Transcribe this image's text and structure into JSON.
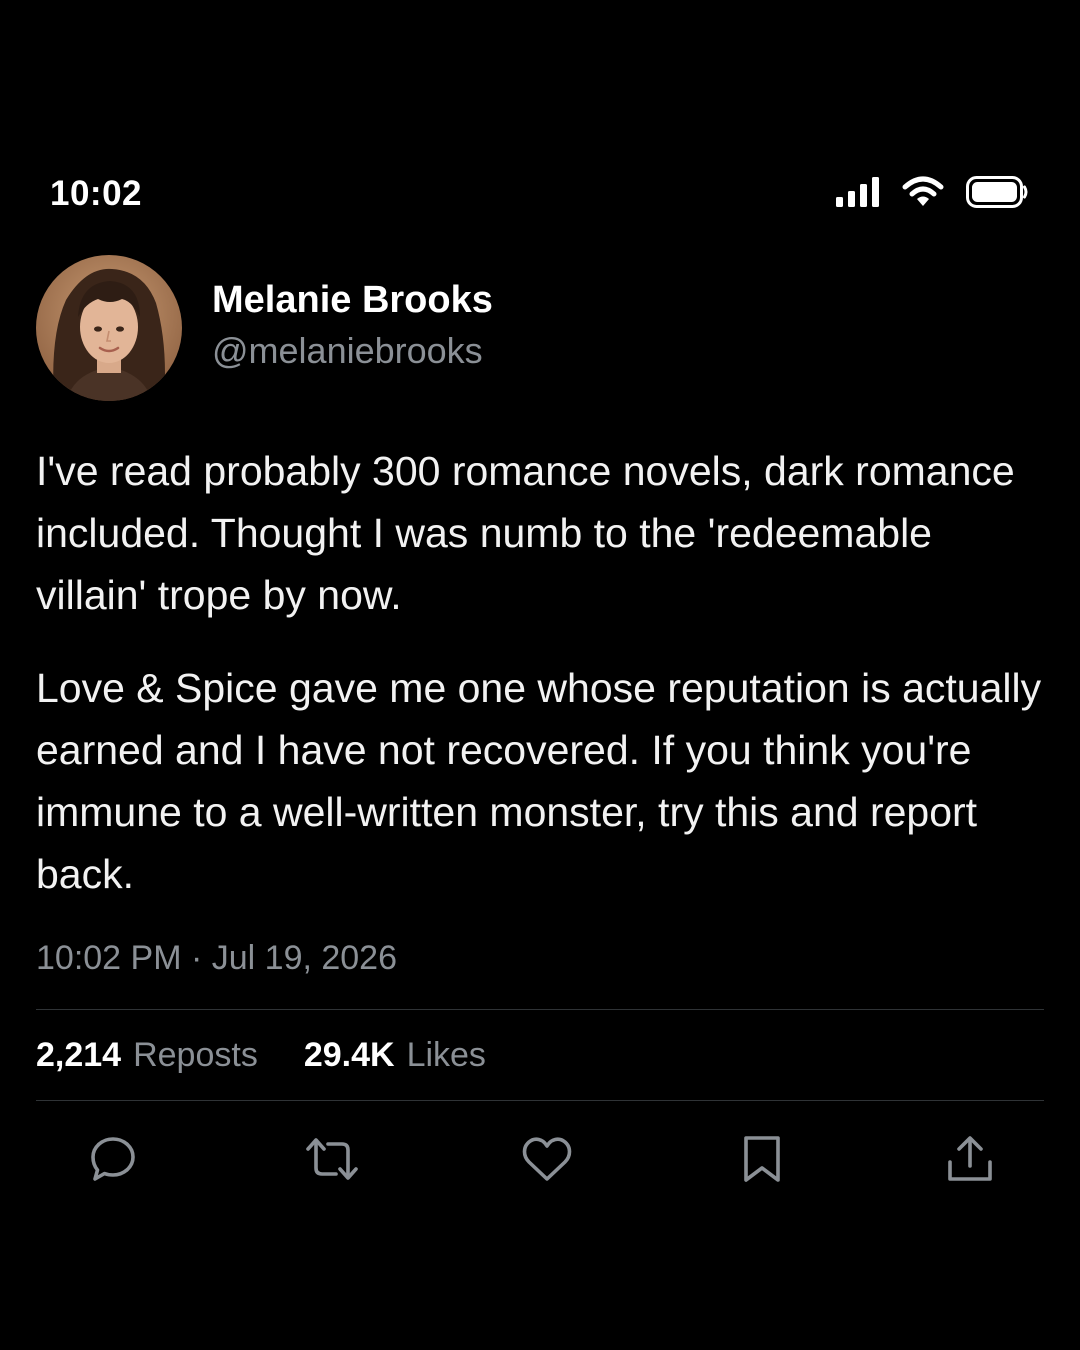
{
  "status_bar": {
    "time": "10:02",
    "icons": [
      "cellular-signal-icon",
      "wifi-icon",
      "battery-icon"
    ]
  },
  "tweet": {
    "author": {
      "display_name": "Melanie Brooks",
      "handle": "@melaniebrooks"
    },
    "paragraphs": [
      "I've read probably 300 romance novels, dark romance included. Thought I was numb to the 'redeemable villain' trope by now.",
      "Love & Spice gave me one whose reputation is actually earned and I have not recovered. If you think you're immune to a well-written monster, try this and report back."
    ],
    "timestamp": "10:02 PM · Jul 19, 2026",
    "stats": {
      "reposts_count": "2,214",
      "reposts_label": "Reposts",
      "likes_count": "29.4K",
      "likes_label": "Likes"
    },
    "actions": [
      "reply-icon",
      "repost-icon",
      "like-icon",
      "bookmark-icon",
      "share-icon"
    ]
  },
  "colors": {
    "background": "#000000",
    "primary_text": "#ffffff",
    "secondary_text": "#8b9096",
    "divider": "#2f3336"
  }
}
